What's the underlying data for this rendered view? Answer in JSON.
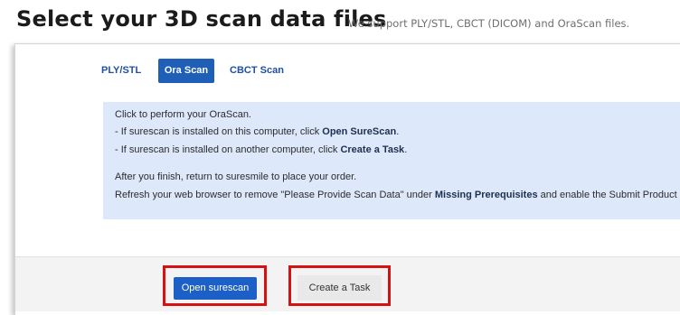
{
  "header": {
    "title": "Select your 3D scan data files",
    "subtitle": "We support PLY/STL, CBCT (DICOM) and OraScan files."
  },
  "tabs": [
    {
      "label": "PLY/STL",
      "active": false
    },
    {
      "label": "Ora Scan",
      "active": true
    },
    {
      "label": "CBCT Scan",
      "active": false
    }
  ],
  "info": {
    "line1": "Click to perform your OraScan.",
    "line2_prefix": "- If surescan is installed on this computer, click ",
    "line2_bold": "Open SureScan",
    "line2_suffix": ".",
    "line3_prefix": "- If surescan is installed on another computer, click ",
    "line3_bold": "Create a Task",
    "line3_suffix": ".",
    "line4": "After you finish, return to suresmile to place your order.",
    "line5_prefix": "Refresh your web browser to remove \"Please Provide Scan Data\" under ",
    "line5_bold": "Missing Prerequisites",
    "line5_suffix": " and enable the Submit Product button"
  },
  "buttons": {
    "open_surescan": "Open surescan",
    "create_task": "Create a Task"
  },
  "colors": {
    "accent": "#1b5fc7",
    "info_background": "#dde8fb",
    "highlight": "#d51111"
  }
}
